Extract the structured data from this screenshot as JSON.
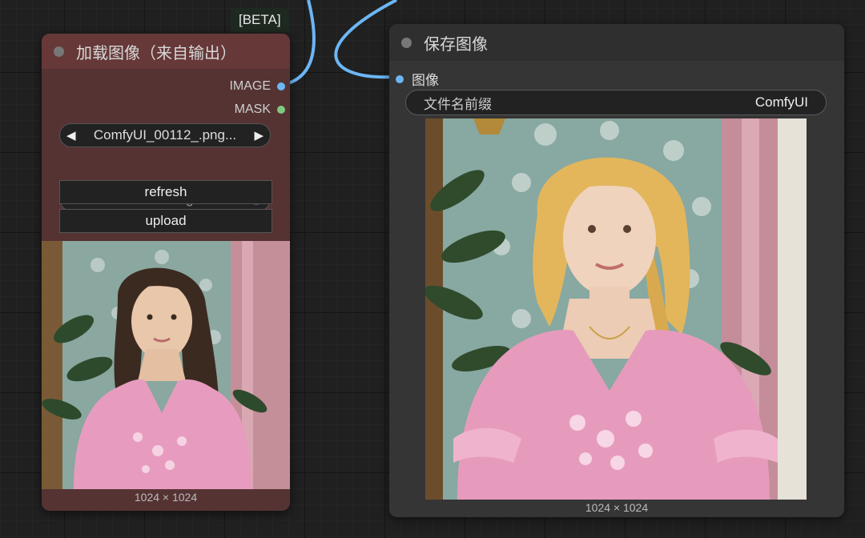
{
  "beta_badge": "[BETA]",
  "load_node": {
    "title": "加载图像（来自输出）",
    "outputs": [
      {
        "label": "IMAGE",
        "color": "#6cb6f5"
      },
      {
        "label": "MASK",
        "color": "#7fca7f"
      }
    ],
    "image_combo": {
      "value": "ComfyUI_00112_.png..."
    },
    "auto_refresh": {
      "label": "Auto-refresh after generation",
      "value": "false"
    },
    "refresh_label": "refresh",
    "upload_label": "upload",
    "preview_dims": "1024 × 1024"
  },
  "save_node": {
    "title": "保存图像",
    "input": {
      "label": "图像",
      "color": "#6cb6f5"
    },
    "prefix": {
      "label": "文件名前缀",
      "value": "ComfyUI"
    },
    "preview_dims": "1024 × 1024"
  },
  "colors": {
    "link": "#6cb6f5",
    "load_node_bg": "#553333",
    "save_node_bg": "#353535"
  }
}
